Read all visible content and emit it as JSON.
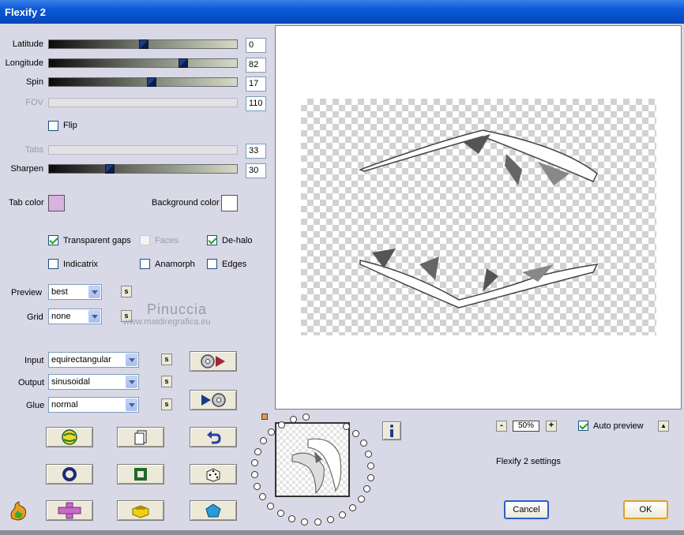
{
  "window": {
    "title": "Flexify 2"
  },
  "sliders": {
    "latitude": {
      "label": "Latitude",
      "value": "0",
      "fraction": 0.5
    },
    "longitude": {
      "label": "Longitude",
      "value": "82",
      "fraction": 0.72
    },
    "spin": {
      "label": "Spin",
      "value": "17",
      "fraction": 0.545
    },
    "fov": {
      "label": "FOV",
      "value": "110"
    },
    "tabs": {
      "label": "Tabs",
      "value": "33"
    },
    "sharpen": {
      "label": "Sharpen",
      "value": "30",
      "fraction": 0.31
    }
  },
  "flip": {
    "label": "Flip",
    "checked": false
  },
  "colors": {
    "tab_color_label": "Tab color",
    "tab_color": "#d9b3e0",
    "background_color_label": "Background color",
    "background_color": "#ffffff"
  },
  "options": {
    "transparent_gaps": {
      "label": "Transparent gaps",
      "checked": true
    },
    "faces": {
      "label": "Faces",
      "checked": false
    },
    "de_halo": {
      "label": "De-halo",
      "checked": true
    },
    "indicatrix": {
      "label": "Indicatrix",
      "checked": false
    },
    "anamorph": {
      "label": "Anamorph",
      "checked": false
    },
    "edges": {
      "label": "Edges",
      "checked": false
    }
  },
  "preview_select": {
    "label": "Preview",
    "value": "best"
  },
  "grid_select": {
    "label": "Grid",
    "value": "none"
  },
  "projection": {
    "input": {
      "label": "Input",
      "value": "equirectangular"
    },
    "output": {
      "label": "Output",
      "value": "sinusoidal"
    },
    "glue": {
      "label": "Glue",
      "value": "normal"
    }
  },
  "small_button_label": "s",
  "watermark": {
    "name": "Pinuccia",
    "url": "www.maidiregrafica.eu"
  },
  "zoom": {
    "minus": "-",
    "value": "50%",
    "plus": "+"
  },
  "auto_preview": {
    "label": "Auto preview",
    "checked": true
  },
  "up_button": "▲",
  "settings_text": "Flexify 2 settings",
  "buttons": {
    "cancel": "Cancel",
    "ok": "OK"
  },
  "icons": {
    "tool_row1": [
      "globe-icon",
      "page-icon",
      "undo-arrow-icon"
    ],
    "tool_row2": [
      "ring-icon",
      "square-frame-icon",
      "dice-icon"
    ],
    "tool_row3": [
      "plus-shape-icon",
      "lego-brick-icon",
      "pentagon-icon"
    ],
    "projection": [
      "disc-play-icon",
      "play-disc-icon"
    ],
    "info": "info-icon",
    "logo": "flame-logo-icon"
  }
}
